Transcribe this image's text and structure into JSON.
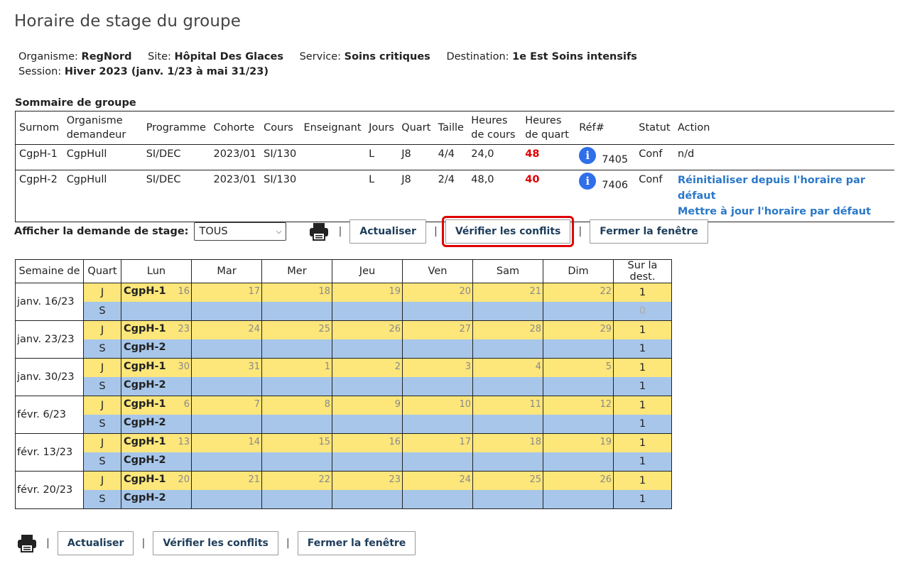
{
  "title": "Horaire de stage du groupe",
  "info": {
    "organisme_label": "Organisme:",
    "organisme": "RegNord",
    "site_label": "Site:",
    "site": "Hôpital Des Glaces",
    "service_label": "Service:",
    "service": "Soins critiques",
    "destination_label": "Destination:",
    "destination": "1e Est Soins intensifs",
    "session_label": "Session:",
    "session": "Hiver 2023 (janv. 1/23 à mai 31/23)"
  },
  "summary": {
    "title": "Sommaire de groupe",
    "headers": [
      "Surnom",
      "Organisme demandeur",
      "Programme",
      "Cohorte",
      "Cours",
      "Enseignant",
      "Jours",
      "Quart",
      "Taille",
      "Heures de cours",
      "Heures de quart",
      "Réf#",
      "Statut",
      "Action"
    ],
    "rows": [
      {
        "surnom": "CgpH-1",
        "organisme": "CgpHull",
        "programme": "SI/DEC",
        "cohorte": "2023/01",
        "cours": "SI/130",
        "enseignant": "",
        "jours": "L",
        "quart": "J8",
        "taille": "4/4",
        "heures_cours": "24,0",
        "heures_quart": "48",
        "ref": "7405",
        "statut": "Conf",
        "action": "n/d"
      },
      {
        "surnom": "CgpH-2",
        "organisme": "CgpHull",
        "programme": "SI/DEC",
        "cohorte": "2023/01",
        "cours": "SI/130",
        "enseignant": "",
        "jours": "L",
        "quart": "J8",
        "taille": "2/4",
        "heures_cours": "48,0",
        "heures_quart": "40",
        "ref": "7406",
        "statut": "Conf",
        "action_links": [
          "Réinitialiser depuis l'horaire par défaut",
          "Mettre à jour l'horaire par défaut"
        ]
      }
    ]
  },
  "toolbar": {
    "filter_label": "Afficher la demande de stage",
    "filter_value": "TOUS",
    "refresh": "Actualiser",
    "check_conflicts": "Vérifier les conflits",
    "close": "Fermer la fenêtre"
  },
  "grid": {
    "headers": [
      "Semaine de",
      "Quart",
      "Lun",
      "Mar",
      "Mer",
      "Jeu",
      "Ven",
      "Sam",
      "Dim",
      "Sur la dest."
    ],
    "weeks": [
      {
        "label": "janv. 16/23",
        "days": [
          "16",
          "17",
          "18",
          "19",
          "20",
          "21",
          "22"
        ],
        "j_group": "CgpH-1",
        "s_group": "",
        "j_dest": "1",
        "s_dest": "0"
      },
      {
        "label": "janv. 23/23",
        "days": [
          "23",
          "24",
          "25",
          "26",
          "27",
          "28",
          "29"
        ],
        "j_group": "CgpH-1",
        "s_group": "CgpH-2",
        "j_dest": "1",
        "s_dest": "1"
      },
      {
        "label": "janv. 30/23",
        "days": [
          "30",
          "31",
          "1",
          "2",
          "3",
          "4",
          "5"
        ],
        "j_group": "CgpH-1",
        "s_group": "CgpH-2",
        "j_dest": "1",
        "s_dest": "1"
      },
      {
        "label": "févr. 6/23",
        "days": [
          "6",
          "7",
          "8",
          "9",
          "10",
          "11",
          "12"
        ],
        "j_group": "CgpH-1",
        "s_group": "CgpH-2",
        "j_dest": "1",
        "s_dest": "1"
      },
      {
        "label": "févr. 13/23",
        "days": [
          "13",
          "14",
          "15",
          "16",
          "17",
          "18",
          "19"
        ],
        "j_group": "CgpH-1",
        "s_group": "CgpH-2",
        "j_dest": "1",
        "s_dest": "1"
      },
      {
        "label": "févr. 20/23",
        "days": [
          "20",
          "21",
          "22",
          "23",
          "24",
          "25",
          "26"
        ],
        "j_group": "CgpH-1",
        "s_group": "CgpH-2",
        "j_dest": "1",
        "s_dest": "1"
      }
    ],
    "shift_j": "J",
    "shift_s": "S"
  },
  "colors": {
    "j_row": "#fde67a",
    "s_row": "#a7c6ea",
    "accent_link": "#2a78c8",
    "alert": "#e00000"
  },
  "icons": {
    "print": "printer-icon",
    "info": "info-icon"
  }
}
